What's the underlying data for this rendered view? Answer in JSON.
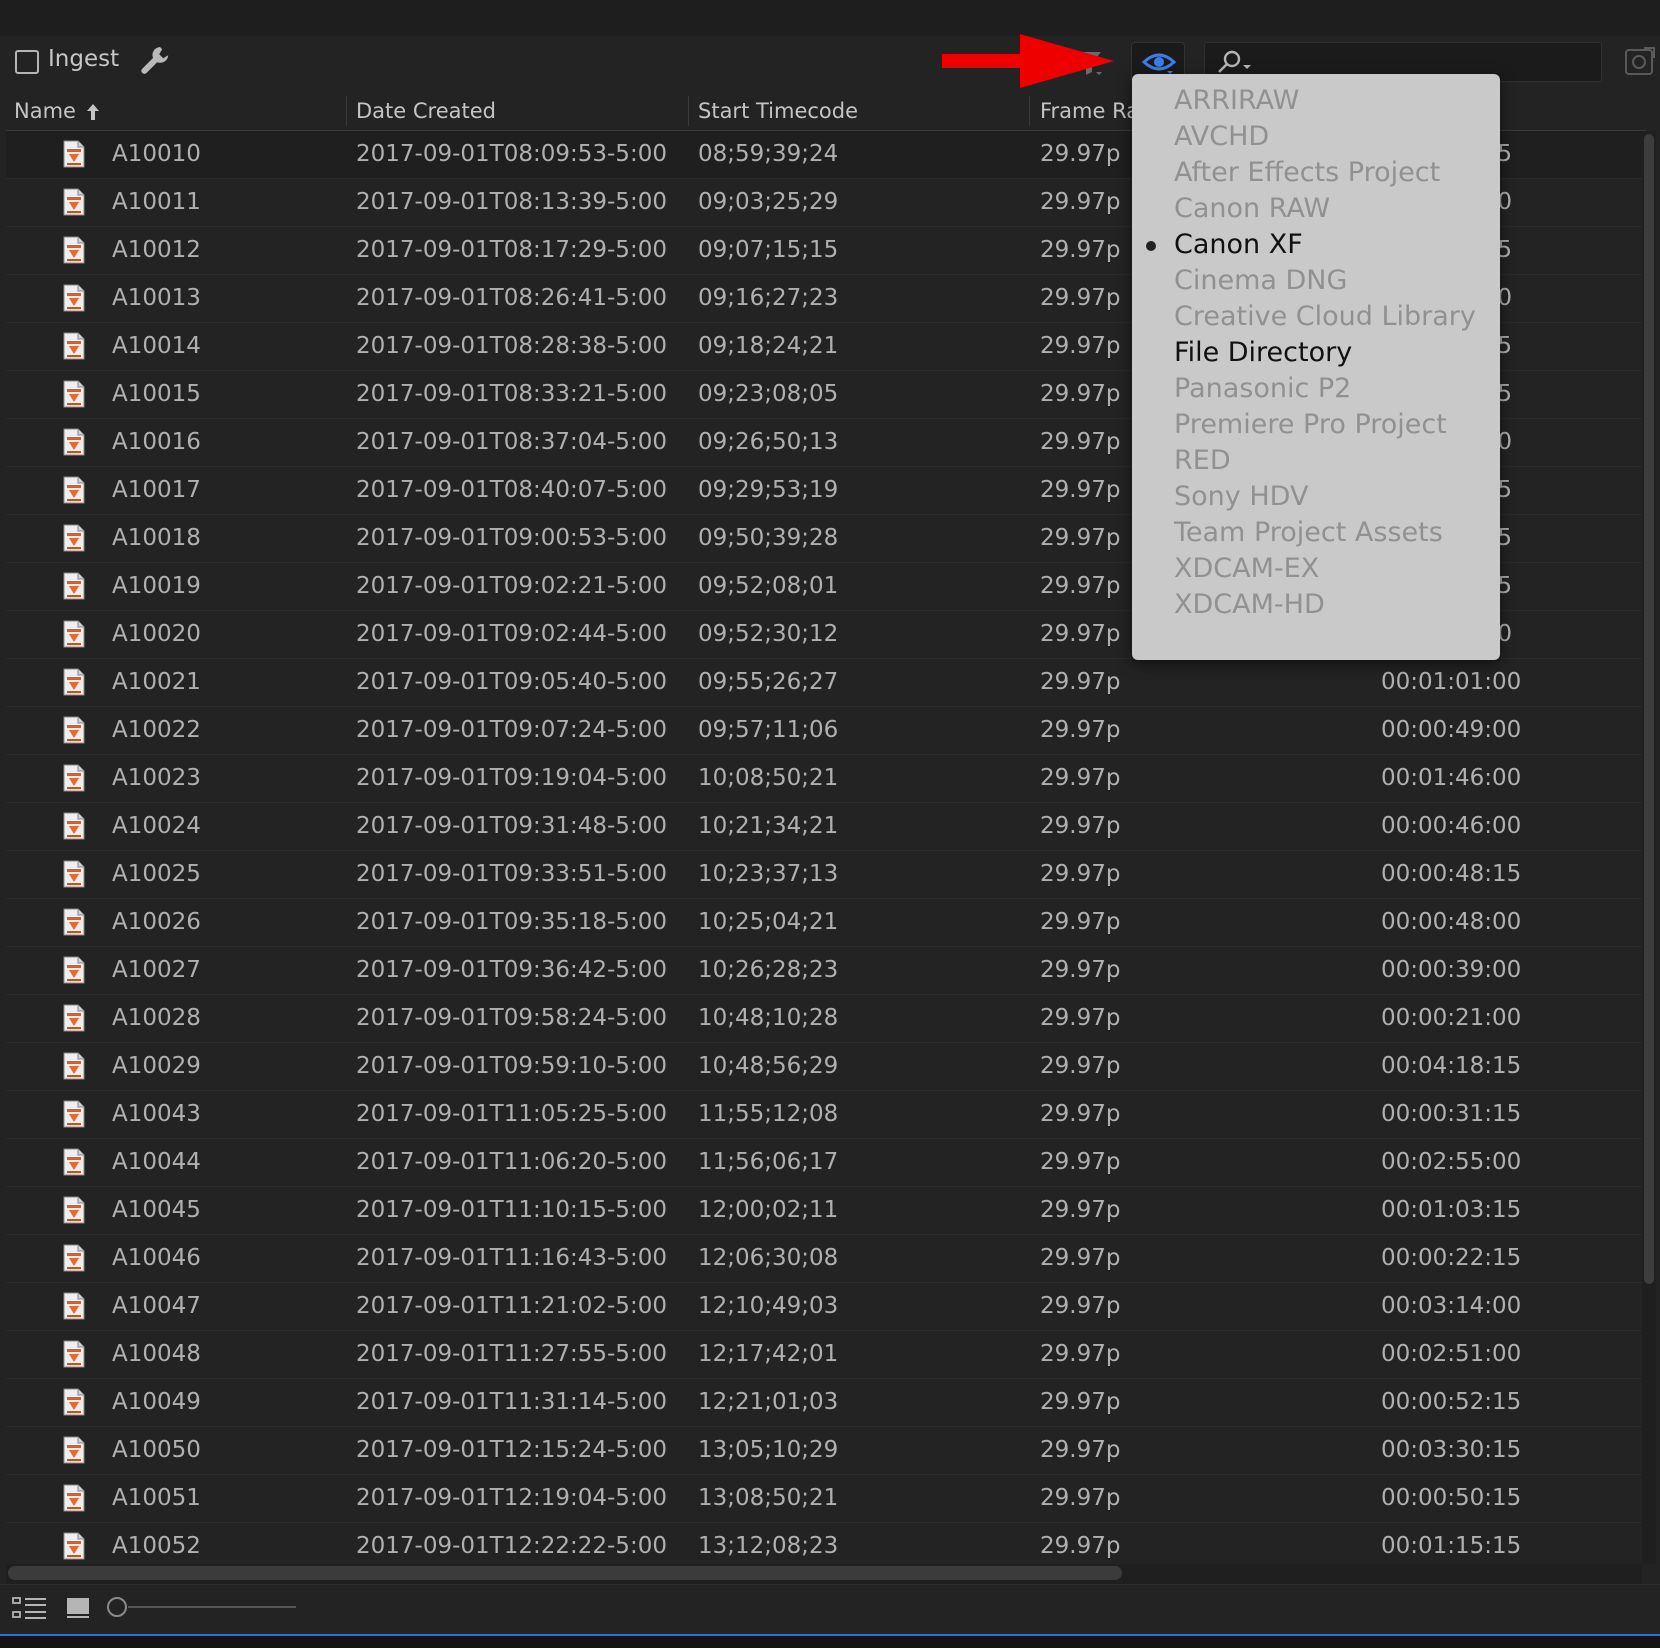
{
  "toolbar": {
    "ingest_label": "Ingest",
    "search": {
      "value": "",
      "placeholder": ""
    }
  },
  "columns": [
    {
      "label": "Name",
      "sort": "ascending"
    },
    {
      "label": "Date Created"
    },
    {
      "label": "Start Timecode"
    },
    {
      "label": "Frame Ra"
    }
  ],
  "rows": [
    {
      "name": "A10010",
      "date": "2017-09-01T08:09:53-5:00",
      "tc": "08;59;39;24",
      "fps": "29.97p",
      "dur": "5"
    },
    {
      "name": "A10011",
      "date": "2017-09-01T08:13:39-5:00",
      "tc": "09;03;25;29",
      "fps": "29.97p",
      "dur": "0"
    },
    {
      "name": "A10012",
      "date": "2017-09-01T08:17:29-5:00",
      "tc": "09;07;15;15",
      "fps": "29.97p",
      "dur": "5"
    },
    {
      "name": "A10013",
      "date": "2017-09-01T08:26:41-5:00",
      "tc": "09;16;27;23",
      "fps": "29.97p",
      "dur": "0"
    },
    {
      "name": "A10014",
      "date": "2017-09-01T08:28:38-5:00",
      "tc": "09;18;24;21",
      "fps": "29.97p",
      "dur": "5"
    },
    {
      "name": "A10015",
      "date": "2017-09-01T08:33:21-5:00",
      "tc": "09;23;08;05",
      "fps": "29.97p",
      "dur": "5"
    },
    {
      "name": "A10016",
      "date": "2017-09-01T08:37:04-5:00",
      "tc": "09;26;50;13",
      "fps": "29.97p",
      "dur": "0"
    },
    {
      "name": "A10017",
      "date": "2017-09-01T08:40:07-5:00",
      "tc": "09;29;53;19",
      "fps": "29.97p",
      "dur": "5"
    },
    {
      "name": "A10018",
      "date": "2017-09-01T09:00:53-5:00",
      "tc": "09;50;39;28",
      "fps": "29.97p",
      "dur": "5"
    },
    {
      "name": "A10019",
      "date": "2017-09-01T09:02:21-5:00",
      "tc": "09;52;08;01",
      "fps": "29.97p",
      "dur": "5"
    },
    {
      "name": "A10020",
      "date": "2017-09-01T09:02:44-5:00",
      "tc": "09;52;30;12",
      "fps": "29.97p",
      "dur": "0"
    },
    {
      "name": "A10021",
      "date": "2017-09-01T09:05:40-5:00",
      "tc": "09;55;26;27",
      "fps": "29.97p",
      "dur": "00:01:01:00"
    },
    {
      "name": "A10022",
      "date": "2017-09-01T09:07:24-5:00",
      "tc": "09;57;11;06",
      "fps": "29.97p",
      "dur": "00:00:49:00"
    },
    {
      "name": "A10023",
      "date": "2017-09-01T09:19:04-5:00",
      "tc": "10;08;50;21",
      "fps": "29.97p",
      "dur": "00:01:46:00"
    },
    {
      "name": "A10024",
      "date": "2017-09-01T09:31:48-5:00",
      "tc": "10;21;34;21",
      "fps": "29.97p",
      "dur": "00:00:46:00"
    },
    {
      "name": "A10025",
      "date": "2017-09-01T09:33:51-5:00",
      "tc": "10;23;37;13",
      "fps": "29.97p",
      "dur": "00:00:48:15"
    },
    {
      "name": "A10026",
      "date": "2017-09-01T09:35:18-5:00",
      "tc": "10;25;04;21",
      "fps": "29.97p",
      "dur": "00:00:48:00"
    },
    {
      "name": "A10027",
      "date": "2017-09-01T09:36:42-5:00",
      "tc": "10;26;28;23",
      "fps": "29.97p",
      "dur": "00:00:39:00"
    },
    {
      "name": "A10028",
      "date": "2017-09-01T09:58:24-5:00",
      "tc": "10;48;10;28",
      "fps": "29.97p",
      "dur": "00:00:21:00"
    },
    {
      "name": "A10029",
      "date": "2017-09-01T09:59:10-5:00",
      "tc": "10;48;56;29",
      "fps": "29.97p",
      "dur": "00:04:18:15"
    },
    {
      "name": "A10043",
      "date": "2017-09-01T11:05:25-5:00",
      "tc": "11;55;12;08",
      "fps": "29.97p",
      "dur": "00:00:31:15"
    },
    {
      "name": "A10044",
      "date": "2017-09-01T11:06:20-5:00",
      "tc": "11;56;06;17",
      "fps": "29.97p",
      "dur": "00:02:55:00"
    },
    {
      "name": "A10045",
      "date": "2017-09-01T11:10:15-5:00",
      "tc": "12;00;02;11",
      "fps": "29.97p",
      "dur": "00:01:03:15"
    },
    {
      "name": "A10046",
      "date": "2017-09-01T11:16:43-5:00",
      "tc": "12;06;30;08",
      "fps": "29.97p",
      "dur": "00:00:22:15"
    },
    {
      "name": "A10047",
      "date": "2017-09-01T11:21:02-5:00",
      "tc": "12;10;49;03",
      "fps": "29.97p",
      "dur": "00:03:14:00"
    },
    {
      "name": "A10048",
      "date": "2017-09-01T11:27:55-5:00",
      "tc": "12;17;42;01",
      "fps": "29.97p",
      "dur": "00:02:51:00"
    },
    {
      "name": "A10049",
      "date": "2017-09-01T11:31:14-5:00",
      "tc": "12;21;01;03",
      "fps": "29.97p",
      "dur": "00:00:52:15"
    },
    {
      "name": "A10050",
      "date": "2017-09-01T12:15:24-5:00",
      "tc": "13;05;10;29",
      "fps": "29.97p",
      "dur": "00:03:30:15"
    },
    {
      "name": "A10051",
      "date": "2017-09-01T12:19:04-5:00",
      "tc": "13;08;50;21",
      "fps": "29.97p",
      "dur": "00:00:50:15"
    },
    {
      "name": "A10052",
      "date": "2017-09-01T12:22:22-5:00",
      "tc": "13;12;08;23",
      "fps": "29.97p",
      "dur": "00:01:15:15"
    }
  ],
  "dropdown": {
    "options": [
      {
        "label": "ARRIRAW",
        "state": "disabled"
      },
      {
        "label": "AVCHD",
        "state": "disabled"
      },
      {
        "label": "After Effects Project",
        "state": "disabled"
      },
      {
        "label": "Canon RAW",
        "state": "disabled"
      },
      {
        "label": "Canon XF",
        "state": "selected"
      },
      {
        "label": "Cinema DNG",
        "state": "disabled"
      },
      {
        "label": "Creative Cloud Library",
        "state": "disabled"
      },
      {
        "label": "File Directory",
        "state": "enabled"
      },
      {
        "label": "Panasonic P2",
        "state": "disabled"
      },
      {
        "label": "Premiere Pro Project",
        "state": "disabled"
      },
      {
        "label": "RED",
        "state": "disabled"
      },
      {
        "label": "Sony HDV",
        "state": "disabled"
      },
      {
        "label": "Team Project Assets",
        "state": "disabled"
      },
      {
        "label": "XDCAM-EX",
        "state": "disabled"
      },
      {
        "label": "XDCAM-HD",
        "state": "disabled"
      }
    ]
  },
  "icons": {
    "wrench": "wrench-icon",
    "filter": "filter-funnel-icon",
    "eye": "eye-icon",
    "search": "search-icon",
    "panel_menu": "panel-menu-icon",
    "file": "clip-file-icon",
    "list_view": "list-view-icon",
    "icon_view": "icon-view-icon",
    "annotation_arrow": "red-arrow-icon"
  },
  "colors": {
    "background": "#232323",
    "accent_blue": "#2f6fd6",
    "eye_blue": "#3d7be8",
    "annotation_red": "#ee0000",
    "dropdown_bg": "#c9c9c9"
  }
}
